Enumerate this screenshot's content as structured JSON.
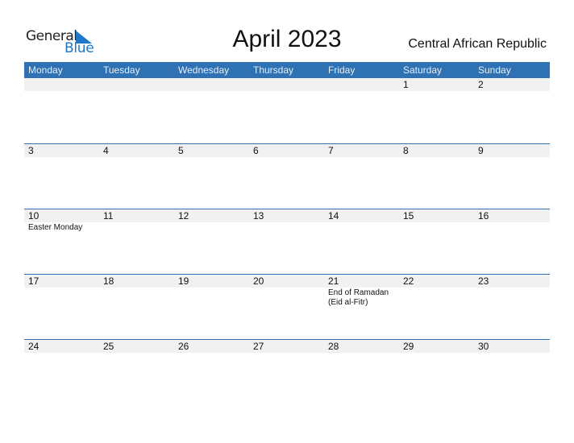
{
  "logo": {
    "part1": "General",
    "part2": "Blue",
    "accent_color": "#1e77c7"
  },
  "title": "April 2023",
  "country": "Central African Republic",
  "header_color": "#2e72b3",
  "weekdays": [
    "Monday",
    "Tuesday",
    "Wednesday",
    "Thursday",
    "Friday",
    "Saturday",
    "Sunday"
  ],
  "weeks": [
    [
      {
        "day": "",
        "event": ""
      },
      {
        "day": "",
        "event": ""
      },
      {
        "day": "",
        "event": ""
      },
      {
        "day": "",
        "event": ""
      },
      {
        "day": "",
        "event": ""
      },
      {
        "day": "1",
        "event": ""
      },
      {
        "day": "2",
        "event": ""
      }
    ],
    [
      {
        "day": "3",
        "event": ""
      },
      {
        "day": "4",
        "event": ""
      },
      {
        "day": "5",
        "event": ""
      },
      {
        "day": "6",
        "event": ""
      },
      {
        "day": "7",
        "event": ""
      },
      {
        "day": "8",
        "event": ""
      },
      {
        "day": "9",
        "event": ""
      }
    ],
    [
      {
        "day": "10",
        "event": "Easter Monday"
      },
      {
        "day": "11",
        "event": ""
      },
      {
        "day": "12",
        "event": ""
      },
      {
        "day": "13",
        "event": ""
      },
      {
        "day": "14",
        "event": ""
      },
      {
        "day": "15",
        "event": ""
      },
      {
        "day": "16",
        "event": ""
      }
    ],
    [
      {
        "day": "17",
        "event": ""
      },
      {
        "day": "18",
        "event": ""
      },
      {
        "day": "19",
        "event": ""
      },
      {
        "day": "20",
        "event": ""
      },
      {
        "day": "21",
        "event": "End of Ramadan (Eid al-Fitr)"
      },
      {
        "day": "22",
        "event": ""
      },
      {
        "day": "23",
        "event": ""
      }
    ],
    [
      {
        "day": "24",
        "event": ""
      },
      {
        "day": "25",
        "event": ""
      },
      {
        "day": "26",
        "event": ""
      },
      {
        "day": "27",
        "event": ""
      },
      {
        "day": "28",
        "event": ""
      },
      {
        "day": "29",
        "event": ""
      },
      {
        "day": "30",
        "event": ""
      }
    ]
  ]
}
